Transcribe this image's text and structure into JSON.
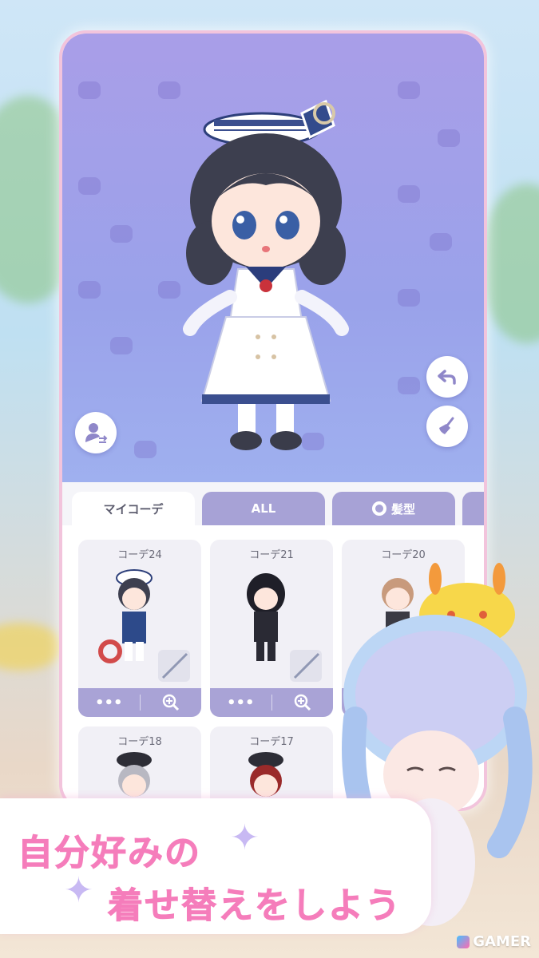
{
  "tabs": [
    {
      "label": "マイコーデ",
      "active": true
    },
    {
      "label": "ALL",
      "active": false
    },
    {
      "label": "髪型",
      "active": false
    }
  ],
  "cards": [
    {
      "title": "コーデ24",
      "more": "•••"
    },
    {
      "title": "コーデ21",
      "more": "•••"
    },
    {
      "title": "コーデ20",
      "more": "•••"
    },
    {
      "title": "コーデ18",
      "more": "•••"
    },
    {
      "title": "コーデ17",
      "more": "•••"
    }
  ],
  "banner": {
    "line1": "自分好みの",
    "line2": "着せ替えをしよう"
  },
  "watermark": "GAMER",
  "colors": {
    "accent_pink": "#f57dbb",
    "tab_inactive": "#a7a2d6",
    "stage_top": "#a99ee8"
  },
  "icons": [
    "undo-icon",
    "broom-icon",
    "swap-avatar-icon",
    "hair-icon",
    "zoom-in-icon"
  ]
}
